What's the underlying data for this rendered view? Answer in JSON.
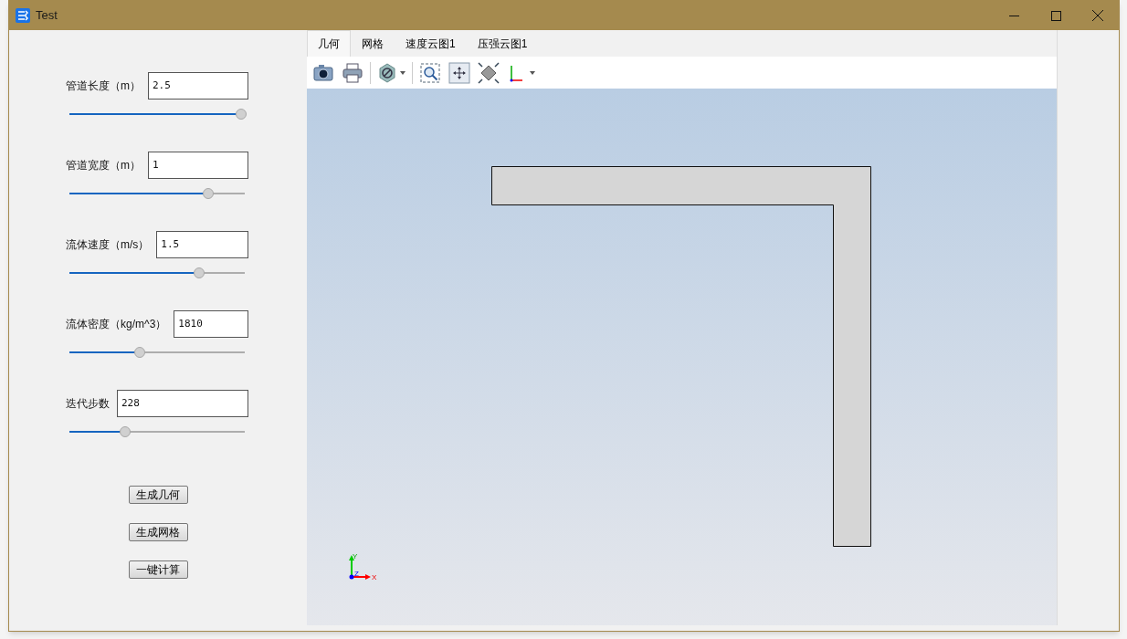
{
  "window": {
    "title": "Test"
  },
  "parameters": [
    {
      "label": "管道长度（m）",
      "value": "2.5",
      "level": 0.98
    },
    {
      "label": "管道宽度（m）",
      "value": "1",
      "level": 0.79
    },
    {
      "label": "流体速度（m/s）",
      "value": "1.5",
      "level": 0.74
    },
    {
      "label": "流体密度（kg/m^3）",
      "value": "1810",
      "level": 0.4
    },
    {
      "label": "迭代步数",
      "value": "228",
      "level": 0.32
    }
  ],
  "buttons": [
    "生成几何",
    "生成网格",
    "一键计算"
  ],
  "tabs": [
    {
      "label": "几何",
      "selected": true
    },
    {
      "label": "网格",
      "selected": false
    },
    {
      "label": "速度云图1",
      "selected": false
    },
    {
      "label": "压强云图1",
      "selected": false
    }
  ],
  "toolbar": [
    {
      "kind": "camera"
    },
    {
      "kind": "printer"
    },
    {
      "kind": "separator"
    },
    {
      "kind": "visibility",
      "dropdown": true
    },
    {
      "kind": "separator"
    },
    {
      "kind": "zoom-box"
    },
    {
      "kind": "pan"
    },
    {
      "kind": "fit"
    },
    {
      "kind": "axes",
      "dropdown": true
    }
  ],
  "viewport": {
    "axis_labels": {
      "x": "X",
      "y": "Y",
      "z": "Z"
    }
  }
}
